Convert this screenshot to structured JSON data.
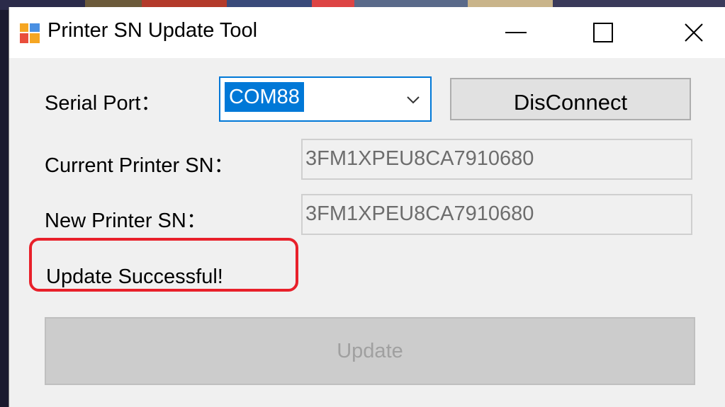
{
  "window": {
    "title": "Printer SN Update Tool",
    "app_icon": "app-window-icon",
    "controls": [
      "minimize-icon",
      "maximize-icon",
      "close-icon"
    ]
  },
  "serial_port": {
    "label": "Serial Port：",
    "selected": "COM88",
    "dropdown_icon": "chevron-down-icon"
  },
  "connect_button": {
    "label": "DisConnect"
  },
  "current_sn": {
    "label": "Current Printer SN：",
    "value": "3FM1XPEU8CA7910680"
  },
  "new_sn": {
    "label": "New Printer SN：",
    "value": "3FM1XPEU8CA7910680"
  },
  "status": {
    "text": "Update Successful!",
    "highlight_color": "#e8202a"
  },
  "update_button": {
    "label": "Update",
    "enabled": false
  },
  "colors": {
    "accent": "#0078d7",
    "window_bg": "#f0f0f0",
    "disabled_text": "#a0a0a0"
  }
}
